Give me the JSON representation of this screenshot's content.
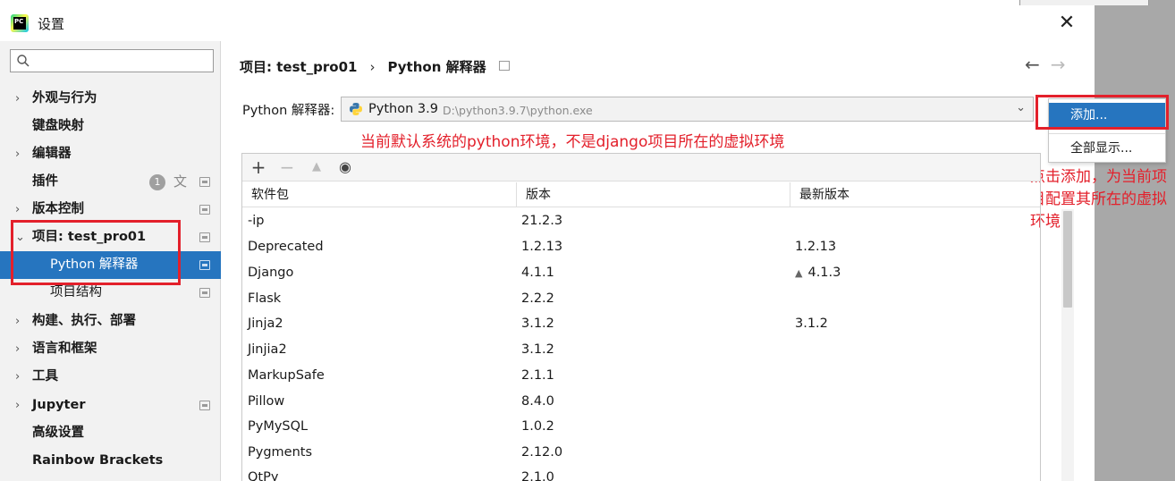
{
  "window": {
    "title": "设置",
    "app_icon": "pycharm-icon",
    "app_icon_text": "PC"
  },
  "search": {
    "placeholder": "",
    "icon": "search-icon"
  },
  "sidebar": {
    "items": [
      {
        "label": "外观与行为",
        "chevron": "›"
      },
      {
        "label": "键盘映射"
      },
      {
        "label": "编辑器",
        "chevron": "›"
      },
      {
        "label": "插件",
        "badge": "1"
      },
      {
        "label": "版本控制",
        "chevron": "›"
      },
      {
        "label": "项目: test_pro01",
        "chevron": "⌄"
      },
      {
        "label": "Python 解释器"
      },
      {
        "label": "项目结构"
      },
      {
        "label": "构建、执行、部署",
        "chevron": "›"
      },
      {
        "label": "语言和框架",
        "chevron": "›"
      },
      {
        "label": "工具",
        "chevron": "›"
      },
      {
        "label": "Jupyter",
        "chevron": "›"
      },
      {
        "label": "高级设置"
      },
      {
        "label": "Rainbow Brackets"
      }
    ]
  },
  "breadcrumb": {
    "parent": "项目: test_pro01",
    "sep": "›",
    "current": "Python 解释器"
  },
  "interpreter": {
    "label": "Python 解释器:",
    "name": "Python 3.9",
    "path": "D:\\python3.9.7\\python.exe"
  },
  "menu": {
    "add": "添加...",
    "show_all": "全部显示..."
  },
  "annotations": {
    "note1": "当前默认系统的python环境，不是django项目所在的虚拟环境",
    "note2": "点击添加，为当前项目配置其所在的虚拟环境"
  },
  "table": {
    "headers": {
      "package": "软件包",
      "version": "版本",
      "latest": "最新版本"
    },
    "rows": [
      {
        "package": "-ip",
        "version": "21.2.3",
        "latest": ""
      },
      {
        "package": "Deprecated",
        "version": "1.2.13",
        "latest": "1.2.13"
      },
      {
        "package": "Django",
        "version": "4.1.1",
        "latest": "4.1.3",
        "upgrade": true
      },
      {
        "package": "Flask",
        "version": "2.2.2",
        "latest": ""
      },
      {
        "package": "Jinja2",
        "version": "3.1.2",
        "latest": "3.1.2"
      },
      {
        "package": "Jinjia2",
        "version": "3.1.2",
        "latest": ""
      },
      {
        "package": "MarkupSafe",
        "version": "2.1.1",
        "latest": ""
      },
      {
        "package": "Pillow",
        "version": "8.4.0",
        "latest": ""
      },
      {
        "package": "PyMySQL",
        "version": "1.0.2",
        "latest": ""
      },
      {
        "package": "Pygments",
        "version": "2.12.0",
        "latest": ""
      },
      {
        "package": "QtPy",
        "version": "2.1.0",
        "latest": ""
      }
    ]
  },
  "colors": {
    "selection": "#2675bf",
    "annotation": "#e3202b"
  }
}
